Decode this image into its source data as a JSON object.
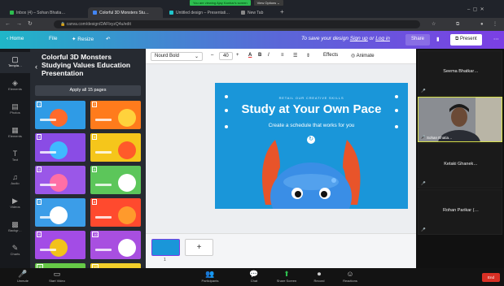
{
  "zoom_banner": {
    "sharing": "You are viewing Ajay Kanhar's screen",
    "options": "View Options ⌄"
  },
  "browser": {
    "tabs": [
      {
        "label": "Inbox (4) – Sohan Bhatia…",
        "color": "#2dbe4f"
      },
      {
        "label": "Colorful 3D Monsters Stu…",
        "color": "#4285f4"
      },
      {
        "label": "Untitled design – Presentati…",
        "color": "#20c4cb"
      },
      {
        "label": "New Tab",
        "color": "#888888"
      }
    ],
    "url": "canva.com/design/DAFlxyzQ4u/edit"
  },
  "header": {
    "home": "Home",
    "file": "File",
    "resize": "Resize",
    "save_prompt_prefix": "To save your design",
    "sign_up": "Sign up",
    "or": "or",
    "log_in": "Log in",
    "share": "Share",
    "present": "Present"
  },
  "rail": [
    {
      "icon": "▢",
      "label": "Templa…",
      "name": "templates"
    },
    {
      "icon": "◈",
      "label": "Elements",
      "name": "elements"
    },
    {
      "icon": "▤",
      "label": "Photos",
      "name": "photos"
    },
    {
      "icon": "▦",
      "label": "Elements",
      "name": "elements-2"
    },
    {
      "icon": "T",
      "label": "Text",
      "name": "text"
    },
    {
      "icon": "♫",
      "label": "Audio",
      "name": "audio"
    },
    {
      "icon": "▶",
      "label": "Videos",
      "name": "videos"
    },
    {
      "icon": "▩",
      "label": "Backgr…",
      "name": "background"
    },
    {
      "icon": "✎",
      "label": "Charts",
      "name": "charts"
    }
  ],
  "panel": {
    "title": "Colorful 3D Monsters Studying Values Education Presentation",
    "apply_all": "Apply all 15 pages"
  },
  "thumbs": [
    {
      "num": "1",
      "bg": "#2f9be6",
      "blob": "#ff6a2c"
    },
    {
      "num": "2",
      "bg": "#ff7b1c",
      "blob": "#ffd23c"
    },
    {
      "num": "3",
      "bg": "#8a4ce5",
      "blob": "#3fb9ff"
    },
    {
      "num": "4",
      "bg": "#f5c61b",
      "blob": "#ff5a2a"
    },
    {
      "num": "5",
      "bg": "#9a57e8",
      "blob": "#ff6fa6"
    },
    {
      "num": "6",
      "bg": "#5cc65a",
      "blob": "#ffffff"
    },
    {
      "num": "7",
      "bg": "#3b9de8",
      "blob": "#ffffff"
    },
    {
      "num": "8",
      "bg": "#ff4a2e",
      "blob": "#ff9a2c"
    },
    {
      "num": "9",
      "bg": "#a34ce6",
      "blob": "#f2c21b"
    },
    {
      "num": "10",
      "bg": "#a84fe0",
      "blob": "#ffffff"
    },
    {
      "num": "11",
      "bg": "#66c947",
      "blob": "#ffffff"
    },
    {
      "num": "12",
      "bg": "#f2cf2a",
      "blob": "#4aa0e8"
    }
  ],
  "toolbar": {
    "font": "Nourd Bold",
    "size": "40",
    "effects": "Effects",
    "animate": "Animate"
  },
  "slide": {
    "subtitle": "RETAIL OUR CREATIVE SKILLS",
    "title": "Study at Your Own Pace",
    "tagline": "Create a schedule that works for you"
  },
  "pages": {
    "page_num": "1",
    "add": "+"
  },
  "participants": [
    {
      "name": "Seema Bhatkar…",
      "video": false
    },
    {
      "name": "Sohan Bhatia…",
      "video": true
    },
    {
      "name": "Ketaki Ghanek…",
      "video": false
    },
    {
      "name": "Rohan Parikar (…",
      "video": false
    }
  ],
  "zoom_controls": [
    {
      "icon": "🎤",
      "label": "Unmute",
      "name": "unmute"
    },
    {
      "icon": "▭",
      "label": "Start Video",
      "name": "start-video"
    },
    {
      "icon": "👥",
      "label": "Participants",
      "name": "participants"
    },
    {
      "icon": "💬",
      "label": "Chat",
      "name": "chat"
    },
    {
      "icon": "⬆",
      "label": "Share Screen",
      "name": "share-screen"
    },
    {
      "icon": "⏺",
      "label": "Record",
      "name": "record"
    },
    {
      "icon": "☺",
      "label": "Reactions",
      "name": "reactions"
    }
  ],
  "end": "End",
  "colors": {
    "canva_grad_start": "#1fb6c8",
    "canva_grad_end": "#7b3fe4",
    "slide_bg": "#1a96d9",
    "monster": "#3a8ee6",
    "horn": "#e8542a"
  }
}
